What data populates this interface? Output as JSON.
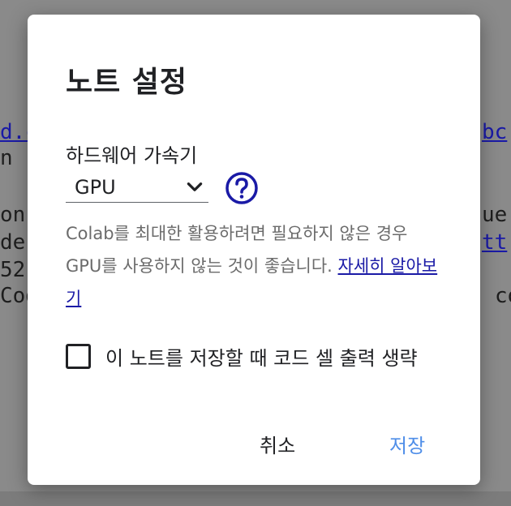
{
  "background": {
    "lines": [
      {
        "text": "d.c",
        "link": true
      },
      {
        "text": "n",
        "link": false
      },
      {
        "text": "on",
        "link": false
      },
      {
        "text": "de",
        "link": false
      },
      {
        "text": "52",
        "link": false
      },
      {
        "text": "Cod",
        "link": false
      },
      {
        "text": "bc",
        "link": true
      },
      {
        "text": "ue",
        "link": false
      },
      {
        "text": "tt",
        "link": true
      },
      {
        "text": "co",
        "link": false
      }
    ]
  },
  "dialog": {
    "title": "노트 설정",
    "hardware_label": "하드웨어 가속기",
    "accelerator": {
      "selected": "GPU"
    },
    "help_icon": "help-circle-icon",
    "description": "Colab를 최대한 활용하려면 필요하지 않은 경우 GPU를 사용하지 않는 것이 좋습니다. ",
    "learn_more": "자세히 알아보기",
    "omit_output_label": "이 노트를 저장할 때 코드 셀 출력 생략",
    "omit_output_checked": false,
    "cancel_label": "취소",
    "save_label": "저장"
  },
  "colors": {
    "accent": "#4f8ee8",
    "link": "#1a1aa6",
    "help_icon": "#1a1aa6"
  }
}
